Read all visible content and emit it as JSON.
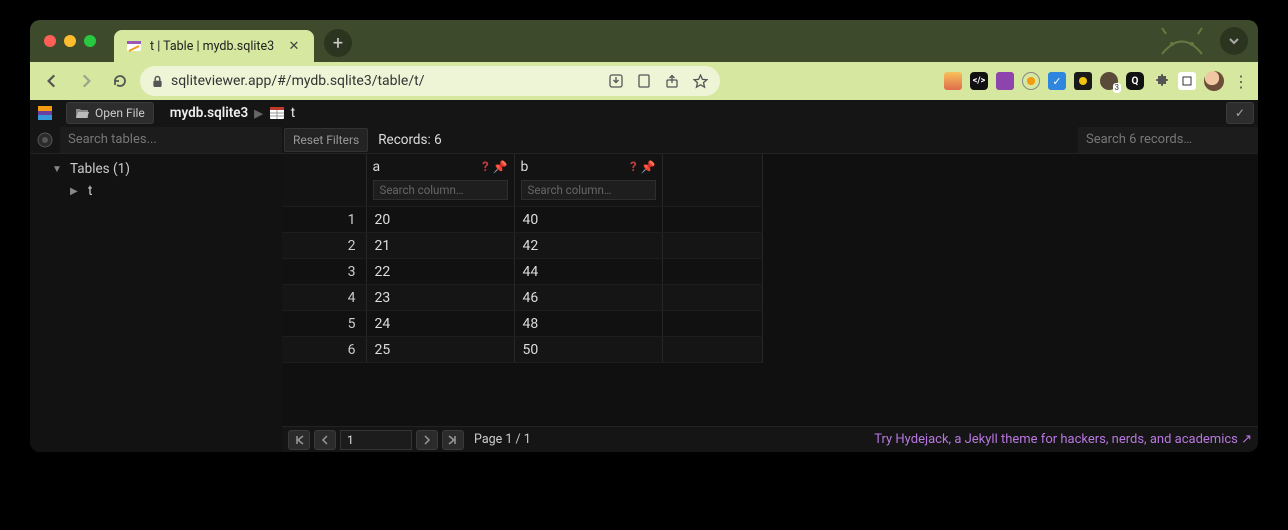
{
  "browser": {
    "tab_title": "t | Table | mydb.sqlite3",
    "url": "sqliteviewer.app/#/mydb.sqlite3/table/t/"
  },
  "app": {
    "open_file_label": "Open File",
    "breadcrumb": {
      "db": "mydb.sqlite3",
      "table": "t"
    },
    "sidebar": {
      "search_placeholder": "Search tables...",
      "tables_header": "Tables (1)",
      "tables": [
        "t"
      ]
    },
    "filters": {
      "reset_label": "Reset Filters",
      "records_label": "Records: 6",
      "search_records_placeholder": "Search 6 records…"
    },
    "columns": [
      {
        "name": "a",
        "search_placeholder": "Search column…"
      },
      {
        "name": "b",
        "search_placeholder": "Search column…"
      }
    ],
    "rows": [
      {
        "n": "1",
        "a": "20",
        "b": "40"
      },
      {
        "n": "2",
        "a": "21",
        "b": "42"
      },
      {
        "n": "3",
        "a": "22",
        "b": "44"
      },
      {
        "n": "4",
        "a": "23",
        "b": "46"
      },
      {
        "n": "5",
        "a": "24",
        "b": "48"
      },
      {
        "n": "6",
        "a": "25",
        "b": "50"
      }
    ],
    "pager": {
      "page_input": "1",
      "page_label": "Page 1 / 1"
    },
    "promo": "Try Hydejack, a Jekyll theme for hackers, nerds, and academics ↗"
  },
  "colors": {
    "accent_green": "#d6e79f",
    "promo_purple": "#b877e0",
    "danger_red": "#c43b3b"
  }
}
